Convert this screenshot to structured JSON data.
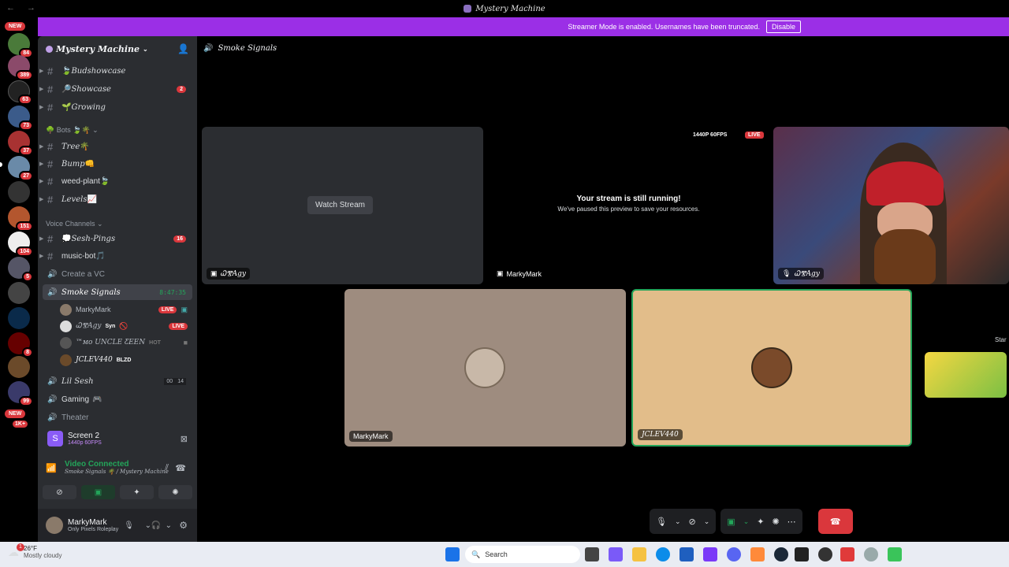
{
  "titlebar": {
    "title": "Mystery Machine",
    "nav": "←  →"
  },
  "server_rail": {
    "new_label_top": "NEW",
    "new_label_bottom": "NEW",
    "badges": [
      "84",
      "389",
      "63",
      "73",
      "37",
      "27",
      "151",
      "104",
      "5",
      "8",
      "99",
      "1K+"
    ]
  },
  "banner": {
    "message": "Streamer Mode is enabled. Usernames have been truncated.",
    "disable_label": "Disable",
    "color": "#9b2fe6"
  },
  "guild": {
    "name": "Mystery Machine"
  },
  "channels": [
    {
      "name": "Budshowcase",
      "emoji": "🍃"
    },
    {
      "name": "Showcase",
      "emoji": "🔎",
      "badge": "2"
    },
    {
      "name": "Growing",
      "emoji": "🌱"
    },
    {
      "name": "Tree",
      "emoji": "🌴"
    },
    {
      "name": "Bump",
      "emoji": "👊"
    },
    {
      "name": "weed-plant",
      "emoji": "🍃"
    },
    {
      "name": "Levels",
      "emoji": "📈"
    }
  ],
  "categories": {
    "bots": "Bots",
    "voice": "Voice Channels"
  },
  "voice_channels": {
    "sesh_pings": {
      "name": "Sesh-Pings",
      "badge": "16"
    },
    "music_bot": {
      "name": "music-bot"
    },
    "create_vc": {
      "name": "Create a VC"
    },
    "smoke_signals": {
      "name": "Smoke Signals",
      "timer": "8:47:35"
    },
    "lil_sesh": {
      "name": "Lil Sesh",
      "count_a": "00",
      "count_b": "14"
    },
    "gaming": {
      "name": "Gaming"
    },
    "theater": {
      "name": "Theater"
    }
  },
  "vc_users": [
    {
      "name": "MarkyMark",
      "live": "LIVE"
    },
    {
      "name": "ᏇⰊAgy",
      "tag": "Syn",
      "live": "LIVE"
    },
    {
      "name": "™ᴍᴏ UNCLE ƸEEN",
      "tag": "HOT"
    },
    {
      "name": "JCLEV440",
      "tag": "BLZD"
    }
  ],
  "screen_panel": {
    "title": "Screen 2",
    "quality": "1440p 60FPS"
  },
  "voice_panel": {
    "status": "Video Connected",
    "location": "Smoke Signals 🌴 / Mystery Machine"
  },
  "user_panel": {
    "name": "MarkyMark",
    "status": "Only Pixels Roleplay"
  },
  "stage": {
    "channel_title": "Smoke Signals",
    "watch_stream_label": "Watch Stream",
    "stream_owner_1": "ᏇⰊAgy",
    "paused_title": "Your stream is still running!",
    "paused_sub": "We've paused this preview to save your resources.",
    "paused_owner": "MarkyMark",
    "quality_badge": "1440P 60FPS",
    "live_badge": "LIVE",
    "webcam_owner": "ᏇⰊAgy",
    "tile_marky": "MarkyMark",
    "tile_jclev": "JCLEV440",
    "side_label": "Star"
  },
  "taskbar": {
    "weather_temp": "26°F",
    "weather_desc": "Mostly cloudy",
    "weather_badge": "1",
    "search_placeholder": "Search"
  }
}
